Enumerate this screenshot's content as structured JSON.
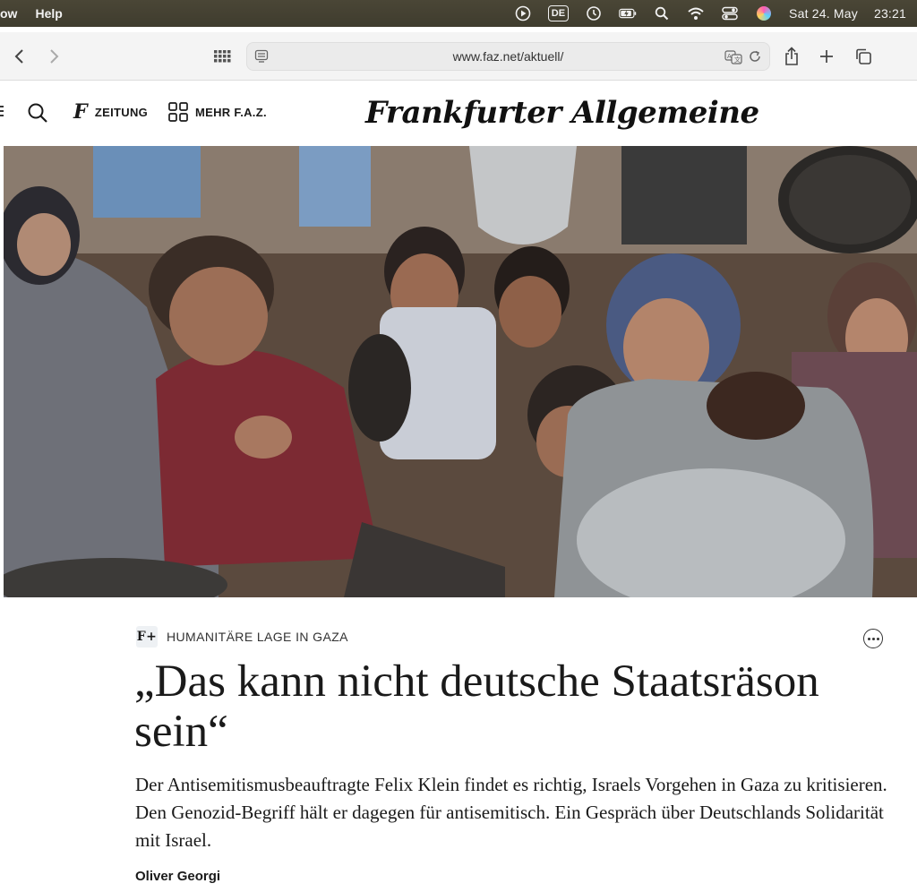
{
  "menubar": {
    "app_menu_partial": "ow",
    "help": "Help",
    "input_language": "DE",
    "date": "Sat 24. May",
    "time": "23:21"
  },
  "browser": {
    "url": "www.faz.net/aktuell/"
  },
  "site_header": {
    "zeitung_label": "ZEITUNG",
    "mehr_label": "MEHR F.A.Z.",
    "logo_text": "Frankfurter Allgemeine"
  },
  "article": {
    "kicker_badge": "F+",
    "kicker": "HUMANITÄRE LAGE IN GAZA",
    "headline": "„Das kann nicht deutsche Staatsräson sein“",
    "teaser": "Der Antisemitismusbeauftragte Felix Klein findet es richtig, Israels Vorgehen in Gaza zu kritisieren. Den Genozid-Begriff hält er dagegen für antisemitisch. Ein Gespräch über Deutschlands Solidarität mit Israel.",
    "author": "Oliver Georgi"
  }
}
